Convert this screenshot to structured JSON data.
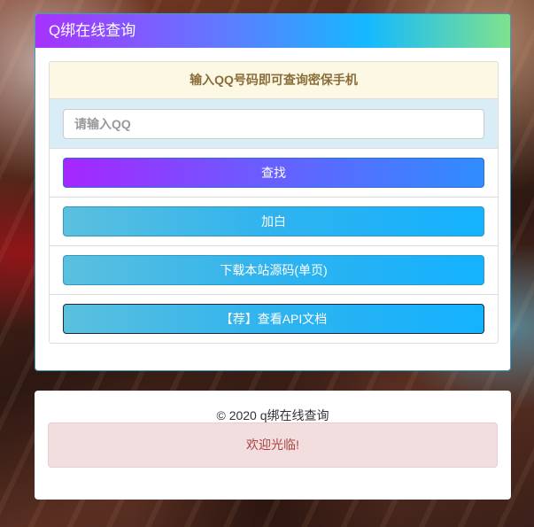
{
  "header": {
    "title": "Q绑在线查询"
  },
  "notice": {
    "text": "输入QQ号码即可查询密保手机"
  },
  "search": {
    "placeholder": "请输入QQ",
    "value": ""
  },
  "buttons": {
    "search": "查找",
    "add_white": "加白",
    "download_source": "下载本站源码(单页)",
    "api_docs": "【荐】查看API文档"
  },
  "footer": {
    "copyright": "© 2020  q绑在线查询",
    "welcome": "欢迎光临!"
  }
}
